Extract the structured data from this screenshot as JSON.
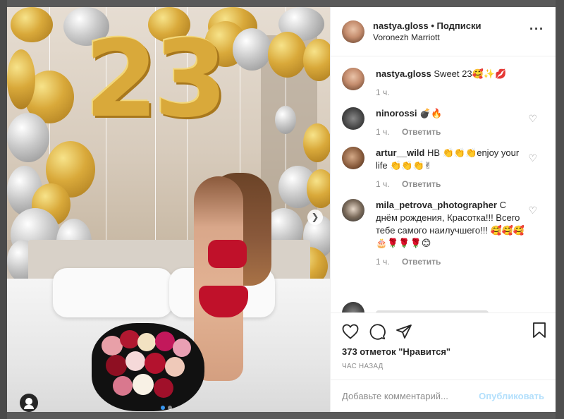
{
  "post": {
    "username": "nastya.gloss",
    "separator": " • ",
    "follow_label": "Подписки",
    "location": "Voronezh Marriott",
    "more_icon": "more-dots-icon"
  },
  "photo": {
    "big_number": "23",
    "next_icon": "chevron-right-icon",
    "tag_icon": "user-tag-icon"
  },
  "comments": [
    {
      "username": "nastya.gloss",
      "text": "Sweet 23🥰✨💋",
      "time": "1 ч.",
      "reply": ""
    },
    {
      "username": "ninorossi",
      "text": "💣🔥",
      "time": "1 ч.",
      "reply": "Ответить"
    },
    {
      "username": "artur__wild",
      "text": "HB 👏👏👏enjoy your life 👏👏👏✌",
      "time": "1 ч.",
      "reply": "Ответить"
    },
    {
      "username": "mila_petrova_photographer",
      "text": "С днём рождения, Красотка!!! Всего тебе самого наилучшего!!! 🥰🥰🥰🎂🌹🌹🌹😊",
      "time": "1 ч.",
      "reply": "Ответить"
    }
  ],
  "actions": {
    "like_icon": "heart-icon",
    "comment_icon": "comment-bubble-icon",
    "share_icon": "share-plane-icon",
    "save_icon": "bookmark-icon",
    "likes_text": "373 отметок \"Нравится\"",
    "timestamp": "ЧАС НАЗАД"
  },
  "composer": {
    "placeholder": "Добавьте комментарий...",
    "post_label": "Опубликовать"
  },
  "colors": {
    "link_blue": "#3897f0",
    "post_disabled": "#b2dffc",
    "muted": "#8e8e8e",
    "text": "#262626"
  }
}
